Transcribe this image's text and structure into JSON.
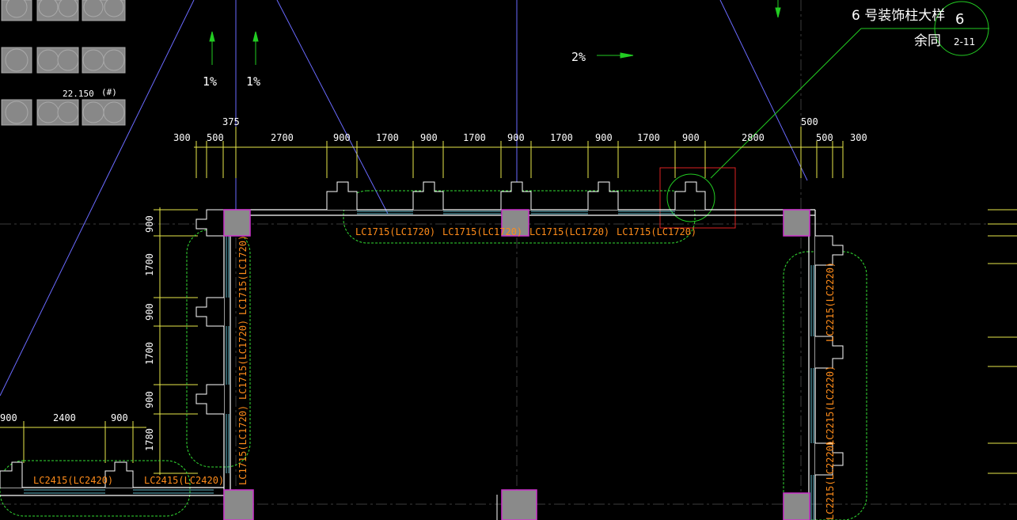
{
  "colors": {
    "background": "#000000",
    "wall": "#ffffff",
    "dimension": "#e8e84a",
    "dimension_text": "#ffffff",
    "window_label": "#ff8c1a",
    "cloud": "#33dd33",
    "column_fill": "#8a8a8a",
    "column_stroke": "#cc33cc",
    "grid_line": "#6a6aff",
    "axis_line": "#444444",
    "arrow": "#22cc22",
    "highlight": "#dd2222"
  },
  "annotation": {
    "title": "6 号装饰柱大样",
    "subtitle": "余同",
    "detail_number": "6",
    "sheet_number": "2-11"
  },
  "slopes": {
    "left_a": "1%",
    "left_b": "1%",
    "top": "2%"
  },
  "elevation": {
    "value": "22.150",
    "note": "(#)"
  },
  "dims_top": {
    "extra_375": "375",
    "extra_500": "500",
    "items": [
      "300",
      "500",
      "2700",
      "900",
      "1700",
      "900",
      "1700",
      "900",
      "1700",
      "900",
      "1700",
      "900",
      "2800",
      "500",
      "300"
    ]
  },
  "dims_left": {
    "items": [
      "900",
      "1700",
      "900",
      "1700",
      "900",
      "1780"
    ]
  },
  "dims_bottom_left": {
    "items": [
      "900",
      "2400",
      "900"
    ]
  },
  "window_labels": {
    "top": [
      "LC1715(LC1720)",
      "LC1715(LC1720)",
      "LC1715(LC1720)",
      "LC1715(LC1720)"
    ],
    "left": [
      "LC1715(LC1720)",
      "LC1715(LC1720)",
      "LC1715(LC1720)"
    ],
    "right": [
      "LC2215(LC2220)",
      "LC2215(LC2220)",
      "LC2215(LC2220)"
    ],
    "bottom_left": [
      "LC2415(LC2420)",
      "LC2415(LC2420)"
    ]
  }
}
